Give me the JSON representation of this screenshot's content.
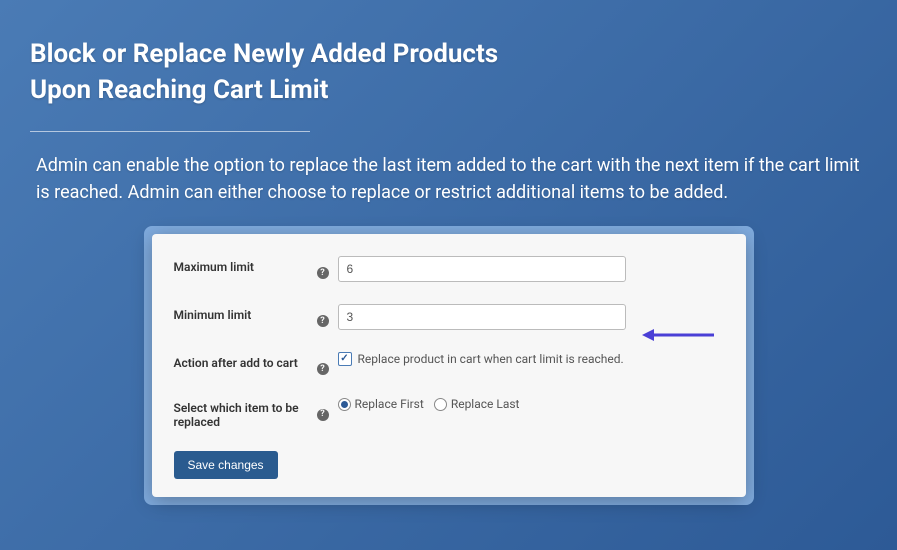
{
  "header": {
    "title_line1": "Block or Replace Newly Added Products",
    "title_line2": "Upon Reaching Cart Limit"
  },
  "description": "Admin can enable the option to replace the last item added to the cart with the next item if the cart limit is reached. Admin can either choose to replace or restrict additional items to be added.",
  "form": {
    "max_limit": {
      "label": "Maximum limit",
      "value": "6"
    },
    "min_limit": {
      "label": "Minimum limit",
      "value": "3"
    },
    "action": {
      "label": "Action after add to cart",
      "checkbox_label": "Replace product in cart when cart limit is reached.",
      "checked": true
    },
    "replace_select": {
      "label": "Select which item to be replaced",
      "option_first": "Replace First",
      "option_last": "Replace Last",
      "selected": "first"
    },
    "save_label": "Save changes"
  },
  "icons": {
    "help": "?",
    "check": "✓"
  },
  "colors": {
    "arrow": "#4a3fd6"
  }
}
